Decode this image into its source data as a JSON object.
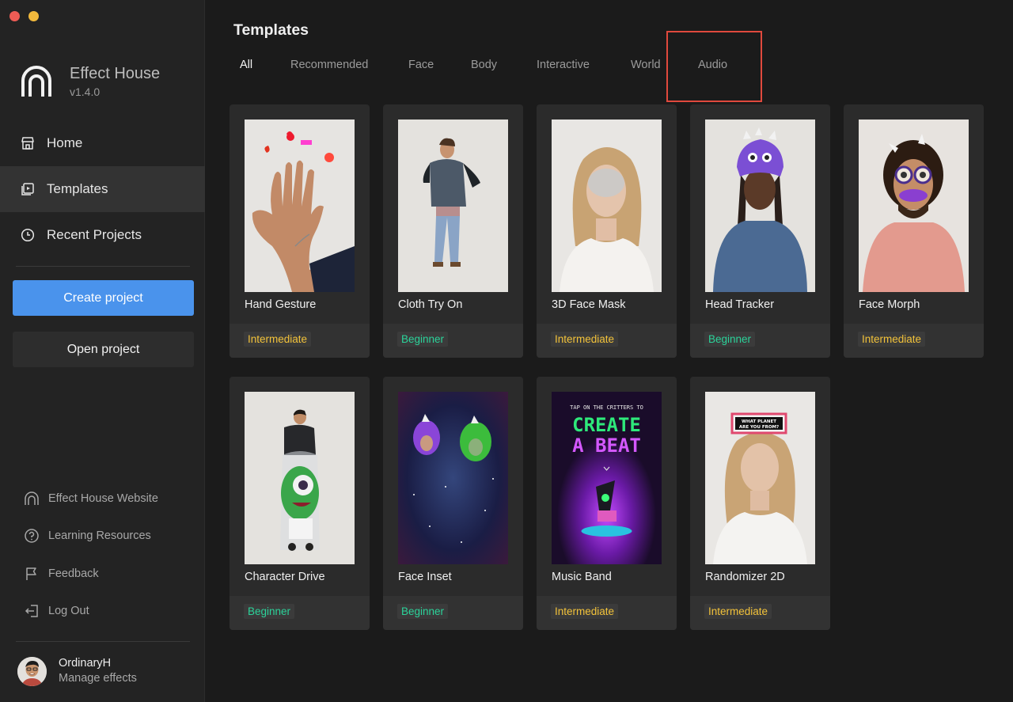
{
  "app": {
    "name": "Effect House",
    "version": "v1.4.0"
  },
  "sidebar": {
    "nav": [
      {
        "label": "Home",
        "icon": "home-icon"
      },
      {
        "label": "Templates",
        "icon": "templates-icon",
        "active": true
      },
      {
        "label": "Recent Projects",
        "icon": "clock-icon"
      }
    ],
    "create_label": "Create project",
    "open_label": "Open project",
    "links": [
      {
        "label": "Effect House Website",
        "icon": "arch-icon"
      },
      {
        "label": "Learning Resources",
        "icon": "help-icon"
      },
      {
        "label": "Feedback",
        "icon": "flag-icon"
      },
      {
        "label": "Log Out",
        "icon": "logout-icon"
      }
    ],
    "user": {
      "name": "OrdinaryH",
      "sub": "Manage effects"
    }
  },
  "main": {
    "title": "Templates",
    "tabs": [
      "All",
      "Recommended",
      "Face",
      "Body",
      "Interactive",
      "World",
      "Audio"
    ],
    "active_tab": "All",
    "highlighted_tab": "Audio",
    "templates": [
      {
        "title": "Hand Gesture",
        "level": "Intermediate"
      },
      {
        "title": "Cloth Try On",
        "level": "Beginner"
      },
      {
        "title": "3D Face Mask",
        "level": "Intermediate"
      },
      {
        "title": "Head Tracker",
        "level": "Beginner"
      },
      {
        "title": "Face Morph",
        "level": "Intermediate"
      },
      {
        "title": "Character Drive",
        "level": "Beginner"
      },
      {
        "title": "Face Inset",
        "level": "Beginner"
      },
      {
        "title": "Music Band",
        "level": "Intermediate"
      },
      {
        "title": "Randomizer 2D",
        "level": "Intermediate"
      }
    ],
    "music_band_text": [
      "TAP ON THE CRITTERS TO",
      "CREATE",
      "A BEAT"
    ],
    "randomizer_sign": [
      "WHAT PLANET",
      "ARE YOU FROM?"
    ]
  },
  "colors": {
    "accent": "#4a93ec",
    "intermediate": "#f3c33a",
    "beginner": "#2bd39a",
    "highlight": "#e0493d"
  }
}
